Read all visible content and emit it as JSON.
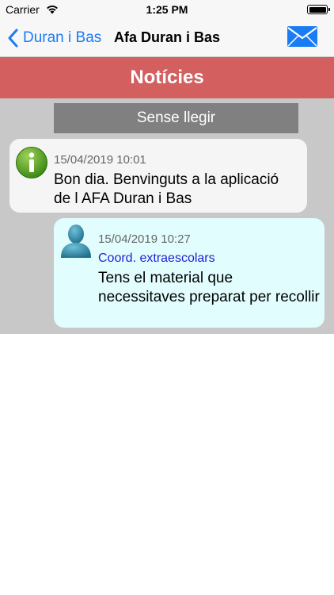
{
  "status_bar": {
    "carrier": "Carrier",
    "time": "1:25 PM"
  },
  "nav": {
    "back_label": "Duran i Bas",
    "title": "Afa Duran i Bas",
    "mail_icon": "mail-icon"
  },
  "section": {
    "title": "Notícies"
  },
  "filter": {
    "label": "Sense llegir"
  },
  "messages": [
    {
      "icon": "info-icon",
      "date": "15/04/2019 10:01",
      "sender": "",
      "text": "Bon dia. Benvinguts a la aplicació de l AFA Duran i Bas"
    },
    {
      "icon": "person-icon",
      "date": "15/04/2019 10:27",
      "sender": "Coord. extraescolars",
      "text": "Tens el material que necessitaves preparat per recollir"
    }
  ],
  "colors": {
    "accent": "#1a7cf5",
    "header_red": "#d45f5f",
    "filter_gray": "#808080",
    "sender_blue": "#1f1fd6",
    "bubble_light": "#f5f5f5",
    "bubble_cyan": "#e2fdfd"
  }
}
